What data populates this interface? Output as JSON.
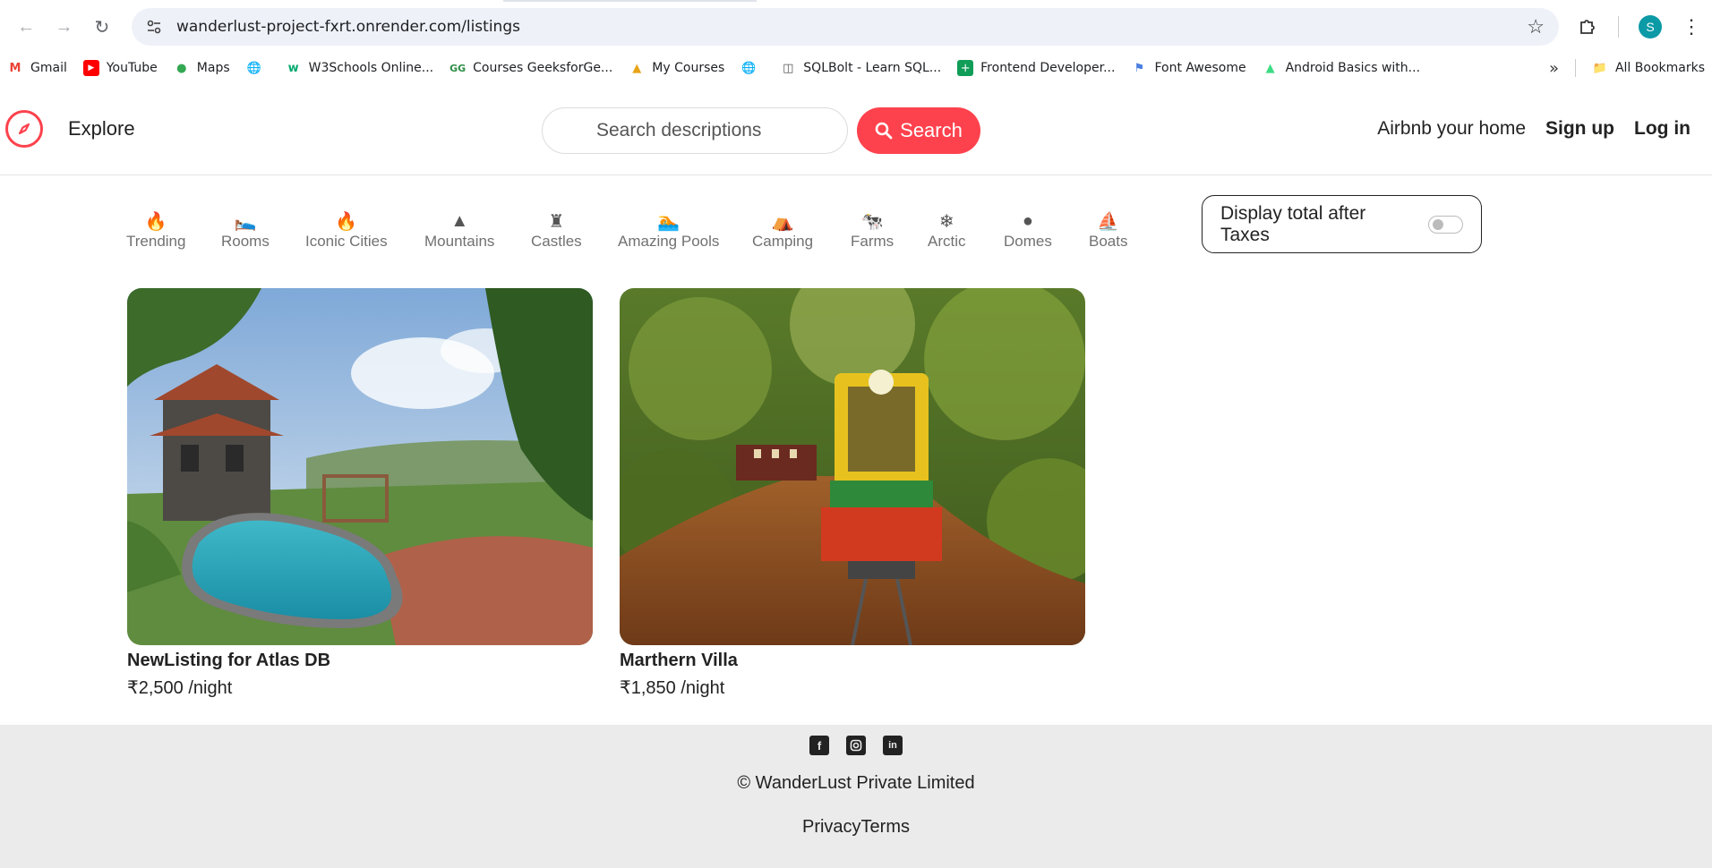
{
  "browser": {
    "url": "wanderlust-project-fxrt.onrender.com/listings",
    "avatar_letter": "S",
    "bookmarks": [
      {
        "label": "Gmail",
        "icon": "gmail-icon"
      },
      {
        "label": "YouTube",
        "icon": "youtube-icon"
      },
      {
        "label": "Maps",
        "icon": "maps-icon"
      },
      {
        "label": "",
        "icon": "globe-icon"
      },
      {
        "label": "W3Schools Online...",
        "icon": "w3schools-icon"
      },
      {
        "label": "Courses GeeksforGe...",
        "icon": "geeksforgeeks-icon"
      },
      {
        "label": "My Courses",
        "icon": "mycourses-icon"
      },
      {
        "label": "",
        "icon": "globe-icon"
      },
      {
        "label": "SQLBolt - Learn SQL...",
        "icon": "database-icon"
      },
      {
        "label": "Frontend Developer...",
        "icon": "sheets-icon"
      },
      {
        "label": "Font Awesome",
        "icon": "flag-icon"
      },
      {
        "label": "Android Basics with...",
        "icon": "android-icon"
      }
    ],
    "all_bookmarks": "All Bookmarks"
  },
  "nav": {
    "explore": "Explore",
    "search_placeholder": "Search descriptions",
    "search_button": "Search",
    "airbnb_home": "Airbnb your home",
    "signup": "Sign up",
    "login": "Log in"
  },
  "filters": [
    {
      "label": "Trending",
      "icon": "fire-icon"
    },
    {
      "label": "Rooms",
      "icon": "bed-icon"
    },
    {
      "label": "Iconic Cities",
      "icon": "mountain-city-icon"
    },
    {
      "label": "Mountains",
      "icon": "mountain-icon"
    },
    {
      "label": "Castles",
      "icon": "castle-icon"
    },
    {
      "label": "Amazing Pools",
      "icon": "person-swimming-icon"
    },
    {
      "label": "Camping",
      "icon": "campground-icon"
    },
    {
      "label": "Farms",
      "icon": "cow-icon"
    },
    {
      "label": "Arctic",
      "icon": "snowflake-icon"
    },
    {
      "label": "Domes",
      "icon": "igloo-icon"
    },
    {
      "label": "Boats",
      "icon": "sailboat-icon"
    }
  ],
  "tax_toggle": {
    "label": "Display total after Taxes",
    "on": false
  },
  "listings": [
    {
      "title": "NewListing for Atlas DB",
      "price": "₹2,500 /night"
    },
    {
      "title": "Marthern Villa",
      "price": "₹1,850 /night"
    }
  ],
  "footer": {
    "copyright": "© WanderLust Private Limited",
    "links": "PrivacyTerms"
  },
  "colors": {
    "brand": "#fe424d",
    "footer_bg": "#ebebeb"
  }
}
